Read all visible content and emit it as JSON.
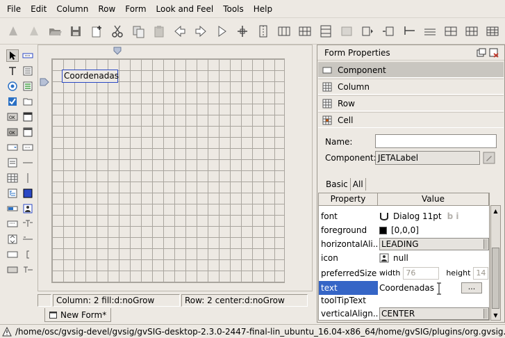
{
  "menu": [
    "File",
    "Edit",
    "Column",
    "Row",
    "Form",
    "Look and Feel",
    "Tools",
    "Help"
  ],
  "toolbar": {
    "icons": [
      "add-component-icon",
      "remove-component-icon",
      "open-icon",
      "save-icon",
      "new-file-icon",
      "cut-icon",
      "copy-icon",
      "paste-icon",
      "undo-icon",
      "redo-icon",
      "run-icon",
      "insert-column-left-icon",
      "insert-column-right-icon",
      "column-icon",
      "row-icon",
      "insert-row-icon",
      "resize-row-icon",
      "align-icon",
      "insert-column-before-icon",
      "insert-column-after-icon",
      "insert-row-before-icon",
      "insert-row-after-icon",
      "grid-icon",
      "table-icon"
    ]
  },
  "canvas": {
    "label_text": "Coordenadas"
  },
  "statusbar": {
    "column": "Column:  2   fill:d:noGrow",
    "row": "Row:  2   center:d:noGrow"
  },
  "form_tab": "New Form*",
  "props": {
    "title": "Form Properties",
    "sections": [
      "Component",
      "Column",
      "Row",
      "Cell"
    ],
    "name_label": "Name:",
    "name_value": "",
    "component_label": "Component:",
    "component_value": "JETALabel",
    "tabs": [
      "Basic",
      "All"
    ],
    "headers": [
      "Property",
      "Value"
    ],
    "rows": [
      {
        "name": "font",
        "value": "Dialog 11pt"
      },
      {
        "name": "foreground",
        "value": "[0,0,0]"
      },
      {
        "name": "horizontalAli...",
        "value": "LEADING"
      },
      {
        "name": "icon",
        "value": "null"
      },
      {
        "name": "preferredSize",
        "width_label": "width",
        "width_value": "76",
        "height_label": "height",
        "height_value": "14"
      },
      {
        "name": "text",
        "value": "Coordenadas"
      },
      {
        "name": "toolTipText",
        "value": ""
      },
      {
        "name": "verticalAlign...",
        "value": "CENTER"
      }
    ],
    "text_edit_button": "...",
    "font_style_glyphs": "b i"
  },
  "status_path": "/home/osc/gvsig-devel/gvsig/gvSIG-desktop-2.3.0-2447-final-lin_ubuntu_16.04-x86_64/home/gvSIG/plugins/org.gvsig.scri...",
  "colors": {
    "selection": "#3565c6",
    "label_border": "#2a47c4"
  }
}
